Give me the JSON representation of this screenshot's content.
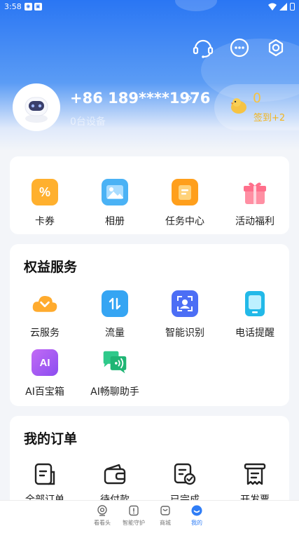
{
  "status_bar": {
    "time": "3:58"
  },
  "profile": {
    "phone": "+86 189****1976",
    "arrow": "›",
    "devices": "0台设备"
  },
  "sign_in": {
    "count": "0",
    "label": "签到+2"
  },
  "quick_actions": [
    {
      "label": "卡券",
      "icon": "coupon-icon"
    },
    {
      "label": "相册",
      "icon": "album-icon"
    },
    {
      "label": "任务中心",
      "icon": "task-center-icon"
    },
    {
      "label": "活动福利",
      "icon": "gift-icon"
    }
  ],
  "benefits": {
    "title": "权益服务",
    "items": [
      {
        "label": "云服务",
        "icon": "cloud-icon"
      },
      {
        "label": "流量",
        "icon": "data-traffic-icon"
      },
      {
        "label": "智能识别",
        "icon": "face-recognition-icon"
      },
      {
        "label": "电话提醒",
        "icon": "phone-reminder-icon"
      },
      {
        "label": "AI百宝箱",
        "icon": "ai-toolbox-icon"
      },
      {
        "label": "AI畅聊助手",
        "icon": "ai-chat-icon"
      }
    ]
  },
  "orders": {
    "title": "我的订单",
    "items": [
      {
        "label": "全部订单",
        "icon": "all-orders-icon"
      },
      {
        "label": "待付款",
        "icon": "wallet-icon"
      },
      {
        "label": "已完成",
        "icon": "completed-icon"
      },
      {
        "label": "开发票",
        "icon": "invoice-icon"
      }
    ]
  },
  "tabs": [
    {
      "label": "看看头",
      "icon": "camera-icon"
    },
    {
      "label": "智能守护",
      "icon": "guard-icon"
    },
    {
      "label": "商城",
      "icon": "shop-icon"
    },
    {
      "label": "我的",
      "icon": "profile-icon",
      "active": true
    }
  ],
  "colors": {
    "primary": "#2f7df6",
    "accent_gold": "#f6c343"
  }
}
